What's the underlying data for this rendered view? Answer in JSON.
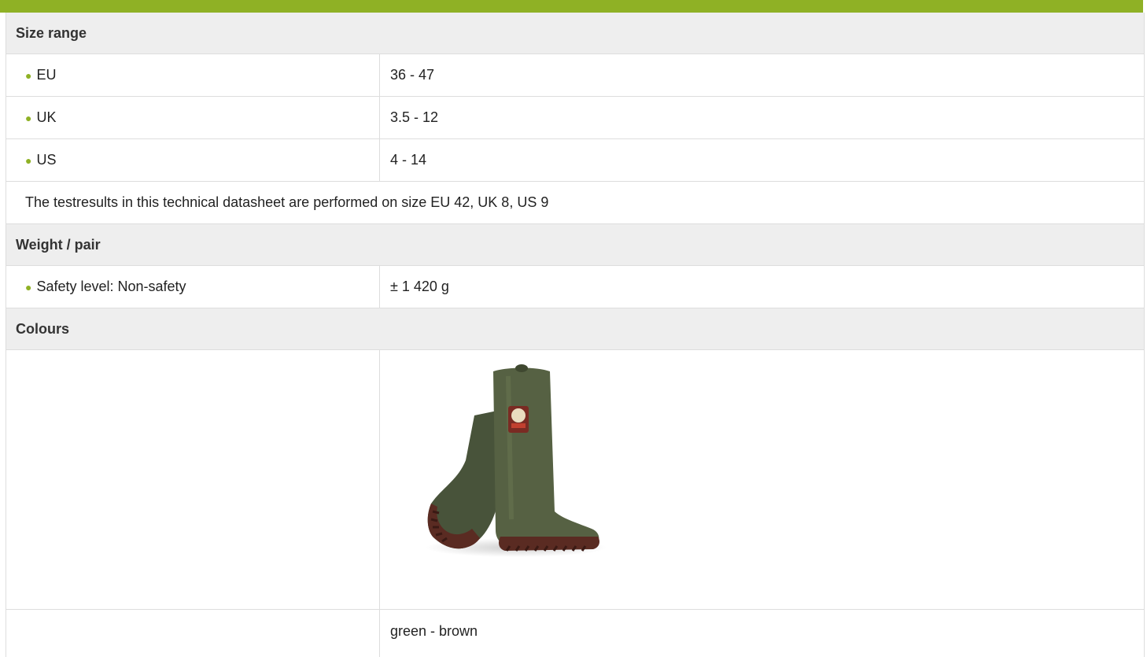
{
  "size_range": {
    "heading": "Size range",
    "rows": [
      {
        "label": "EU",
        "value": "36 - 47"
      },
      {
        "label": "UK",
        "value": "3.5 - 12"
      },
      {
        "label": "US",
        "value": "4 - 14"
      }
    ],
    "note": "The testresults in this technical datasheet are performed on size EU 42, UK 8, US 9"
  },
  "weight": {
    "heading": "Weight / pair",
    "rows": [
      {
        "label": "Safety level: Non-safety",
        "value": "± 1 420 g"
      }
    ]
  },
  "colours": {
    "heading": "Colours",
    "image_label": "",
    "colour_name": "green - brown",
    "boot_colors": {
      "upper": "#4f5a3e",
      "sole": "#5a2b22",
      "accent_bar": "#8fb125"
    }
  }
}
